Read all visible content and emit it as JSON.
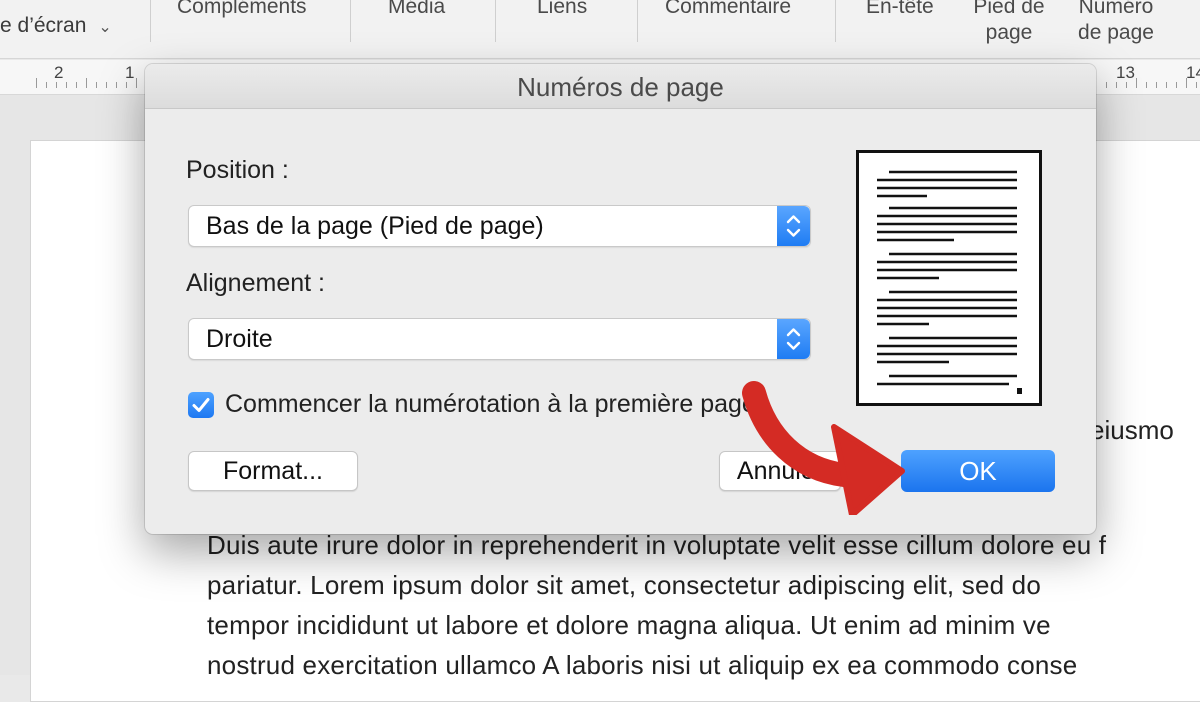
{
  "ribbon": {
    "left_label": "e d’écran",
    "items": [
      {
        "label": "Compléments"
      },
      {
        "label": "Média"
      },
      {
        "label": "Liens"
      },
      {
        "label": "Commentaire"
      },
      {
        "label": "En-tête"
      },
      {
        "label": "Pied de page"
      },
      {
        "label": "Numéro de page"
      }
    ]
  },
  "ruler": {
    "labels_left": [
      "2",
      "1"
    ],
    "labels_right": [
      "13",
      "14"
    ]
  },
  "document": {
    "fragment": "eiusmo",
    "lines": [
      "Duis aute irure dolor in reprehenderit in voluptate velit esse cillum dolore eu f",
      "pariatur. Lorem ipsum dolor sit amet, consectetur adipiscing elit, sed do",
      "tempor incididunt ut labore et dolore magna aliqua. Ut enim ad minim ve",
      "nostrud exercitation ullamco A laboris nisi ut aliquip ex ea commodo conse"
    ]
  },
  "dialog": {
    "title": "Numéros de page",
    "position_label": "Position :",
    "position_value": "Bas de la page (Pied de page)",
    "alignment_label": "Alignement :",
    "alignment_value": "Droite",
    "checkbox_label": "Commencer la numérotation à la première page",
    "checkbox_checked": true,
    "format_button": "Format...",
    "cancel_button": "Annuler",
    "ok_button": "OK"
  },
  "colors": {
    "accent": "#1f7cf3",
    "annotation_arrow": "#d42b24"
  },
  "icons": [
    "chevron-down-icon",
    "stepper-icon",
    "checkmark-icon",
    "arrow-annotation-icon"
  ]
}
